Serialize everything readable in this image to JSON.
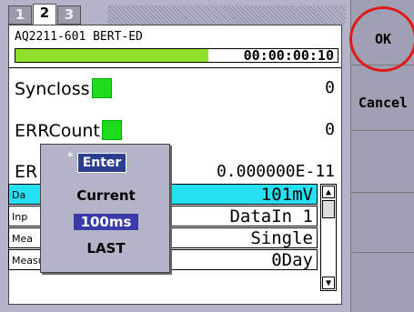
{
  "tabs": [
    "1",
    "2",
    "3"
  ],
  "active_tab": "2",
  "header": {
    "model": "AQ2211-601 BERT-ED",
    "progress_fraction": 0.6,
    "elapsed": "00:00:00:10"
  },
  "measurements": [
    {
      "label": "Syncloss",
      "value": "0",
      "indicator_color": "#1fdc1f"
    },
    {
      "label": "ERRCount",
      "value": "0",
      "indicator_color": "#1fdc1f"
    },
    {
      "label": "ER",
      "value": "0.000000E-11"
    }
  ],
  "settings": [
    {
      "label": "Da",
      "value": "101mV"
    },
    {
      "label": "Inp",
      "value": "DataIn 1"
    },
    {
      "label": "Mea",
      "value": "Single"
    },
    {
      "label": "Measure Day",
      "value": "0Day"
    }
  ],
  "popup": {
    "badge": "Enter",
    "options": [
      "Current",
      "100ms",
      "LAST"
    ],
    "selected": "100ms"
  },
  "softkeys": {
    "ok": "OK",
    "cancel": "Cancel"
  },
  "colors": {
    "selected_row": "#25e0f0",
    "indicator": "#1fdc1f",
    "highlight": "#e01818"
  }
}
